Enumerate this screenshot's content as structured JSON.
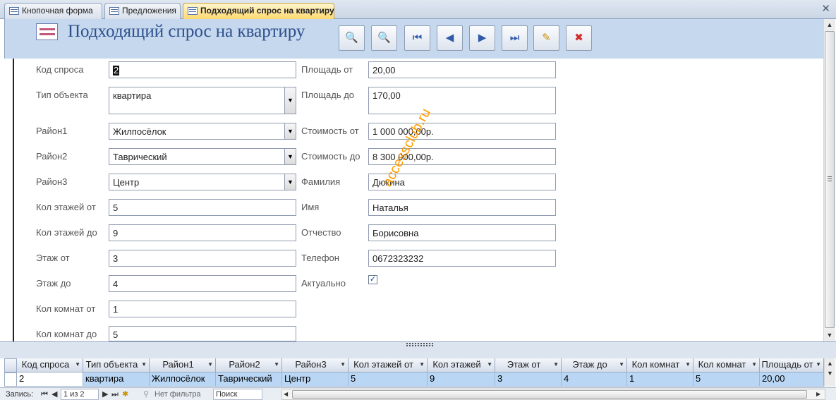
{
  "tabs": [
    {
      "label": "Кнопочная форма",
      "active": false
    },
    {
      "label": "Предложения",
      "active": false
    },
    {
      "label": "Подходящий спрос на квартиру",
      "active": true
    }
  ],
  "form": {
    "title": "Подходящий спрос на квартиру",
    "buttons": [
      {
        "name": "find",
        "glyph": "🔍"
      },
      {
        "name": "find-next",
        "glyph": "🔍"
      },
      {
        "name": "first-record",
        "glyph": "⏮"
      },
      {
        "name": "previous-record",
        "glyph": "◀"
      },
      {
        "name": "next-record",
        "glyph": "▶"
      },
      {
        "name": "last-record",
        "glyph": "⏭"
      },
      {
        "name": "new-record",
        "glyph": "✎"
      },
      {
        "name": "delete-record",
        "glyph": "✖"
      }
    ],
    "left_fields": [
      {
        "label": "Код спроса",
        "value": "2"
      },
      {
        "label": "Тип объекта",
        "value": "квартира"
      },
      {
        "label": "Район1",
        "value": "Жилпосёлок"
      },
      {
        "label": "Район2",
        "value": "Таврический"
      },
      {
        "label": "Район3",
        "value": "Центр"
      },
      {
        "label": "Кол этажей от",
        "value": "5"
      },
      {
        "label": "Кол этажей до",
        "value": "9"
      },
      {
        "label": "Этаж от",
        "value": "3"
      },
      {
        "label": "Этаж до",
        "value": "4"
      },
      {
        "label": "Кол комнат от",
        "value": "1"
      },
      {
        "label": "Кол комнат до",
        "value": "5"
      }
    ],
    "right_fields": [
      {
        "label": "Площадь от",
        "value": "20,00"
      },
      {
        "label": "Площадь до",
        "value": "170,00"
      },
      {
        "label": "Стоимость от",
        "value": "1 000 000,00р."
      },
      {
        "label": "Стоимость до",
        "value": "8 300 000,00р."
      },
      {
        "label": "Фамилия",
        "value": "Дюкина"
      },
      {
        "label": "Имя",
        "value": "Наталья"
      },
      {
        "label": "Отчество",
        "value": "Борисовна"
      },
      {
        "label": "Телефон",
        "value": "0672323232"
      },
      {
        "label": "Актуально",
        "value": "✓"
      }
    ],
    "watermark": "accessclub.ru"
  },
  "datasheet": {
    "headers": [
      "Код спроса",
      "Тип объекта",
      "Район1",
      "Район2",
      "Район3",
      "Кол этажей от",
      "Кол этажей",
      "Этаж от",
      "Этаж до",
      "Кол комнат",
      "Кол комнат",
      "Площадь от"
    ],
    "row": [
      "2",
      "квартира",
      "Жилпосёлок",
      "Таврический",
      "Центр",
      "5",
      "9",
      "3",
      "4",
      "1",
      "5",
      "20,00"
    ]
  },
  "navigator": {
    "record_label": "Запись:",
    "position": "1 из 2",
    "filter": "Нет фильтра",
    "search": "Поиск"
  }
}
